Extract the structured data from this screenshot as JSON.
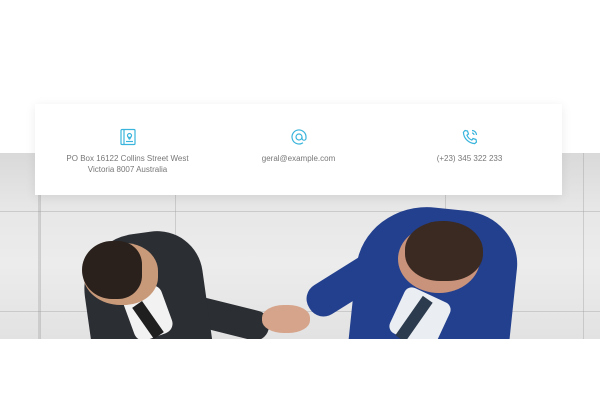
{
  "contact": {
    "address": {
      "icon": "map-book-icon",
      "line1": "PO Box 16122 Collins Street West",
      "line2": "Victoria 8007 Australia"
    },
    "email": {
      "icon": "at-sign-icon",
      "value": "geral@example.com"
    },
    "phone": {
      "icon": "phone-icon",
      "value": "(+23) 345 322 233"
    }
  },
  "colors": {
    "accent": "#39b4dc",
    "text": "#777777",
    "card": "#ffffff"
  },
  "hero": {
    "image": "businessmen-handshake-photo"
  }
}
